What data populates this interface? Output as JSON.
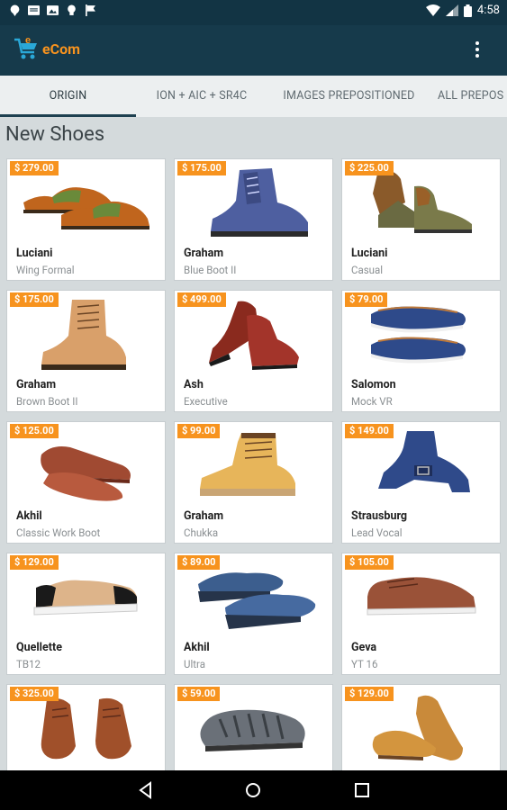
{
  "status_bar": {
    "time": "4:58"
  },
  "app": {
    "name": "eCom",
    "accent_color": "#f7931e",
    "bar_color": "#163a4b"
  },
  "tabs": [
    {
      "label": "ORIGIN",
      "active": true
    },
    {
      "label": "ION + AIC + SR4C",
      "active": false
    },
    {
      "label": "IMAGES PREPOSITIONED",
      "active": false
    },
    {
      "label": "ALL PREPOS",
      "active": false
    }
  ],
  "section": {
    "title": "New Shoes"
  },
  "products": [
    {
      "price": "$ 279.00",
      "brand": "Luciani",
      "model": "Wing Formal"
    },
    {
      "price": "$ 175.00",
      "brand": "Graham",
      "model": "Blue Boot II"
    },
    {
      "price": "$ 225.00",
      "brand": "Luciani",
      "model": "Casual"
    },
    {
      "price": "$ 175.00",
      "brand": "Graham",
      "model": "Brown Boot II"
    },
    {
      "price": "$ 499.00",
      "brand": "Ash",
      "model": "Executive"
    },
    {
      "price": "$ 79.00",
      "brand": "Salomon",
      "model": "Mock VR"
    },
    {
      "price": "$ 125.00",
      "brand": "Akhil",
      "model": "Classic Work Boot"
    },
    {
      "price": "$ 99.00",
      "brand": "Graham",
      "model": "Chukka"
    },
    {
      "price": "$ 149.00",
      "brand": "Strausburg",
      "model": "Lead Vocal"
    },
    {
      "price": "$ 129.00",
      "brand": "Quellette",
      "model": "TB12"
    },
    {
      "price": "$ 89.00",
      "brand": "Akhil",
      "model": "Ultra"
    },
    {
      "price": "$ 105.00",
      "brand": "Geva",
      "model": "YT 16"
    },
    {
      "price": "$ 325.00",
      "brand": "",
      "model": ""
    },
    {
      "price": "$ 59.00",
      "brand": "",
      "model": ""
    },
    {
      "price": "$ 129.00",
      "brand": "",
      "model": ""
    }
  ]
}
